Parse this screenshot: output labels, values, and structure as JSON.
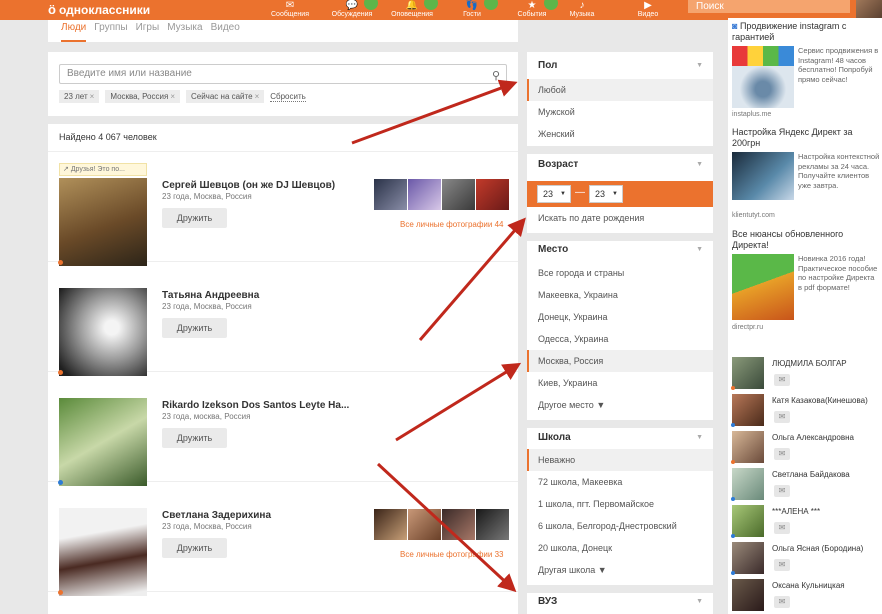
{
  "header": {
    "logo_text": "одноклассники",
    "nav": [
      {
        "label": "Сообщения",
        "icon": "envelope-icon",
        "glyph": "✉"
      },
      {
        "label": "Обсуждения",
        "icon": "chat-icon",
        "glyph": "💬"
      },
      {
        "label": "Оповещения",
        "icon": "bell-icon",
        "glyph": "🔔"
      },
      {
        "label": "Гости",
        "icon": "guests-icon",
        "glyph": "👣"
      },
      {
        "label": "События",
        "icon": "events-icon",
        "glyph": "★"
      },
      {
        "label": "Музыка",
        "icon": "music-icon",
        "glyph": "♪"
      },
      {
        "label": "Видео",
        "icon": "video-icon",
        "glyph": "▶"
      }
    ],
    "search_placeholder": "Поиск"
  },
  "subnav": {
    "tabs": [
      "Люди",
      "Группы",
      "Игры",
      "Музыка",
      "Видео"
    ]
  },
  "search": {
    "placeholder": "Введите имя или название",
    "chips": [
      "23 лет",
      "Москва, Россия",
      "Сейчас на сайте"
    ],
    "reset_label": "Сбросить"
  },
  "results": {
    "found_text": "Найдено 4 067 человек",
    "friends_label": "Друзья! Это по...",
    "add_friend_label": "Дружить",
    "people": [
      {
        "name": "Сергей Шевцов (он же DJ Шевцов)",
        "meta": "23 года, Москва, Россия",
        "all_photos": "Все личные фотографии 44"
      },
      {
        "name": "Татьяна Андреевна",
        "meta": "23 года, Москва, Россия",
        "all_photos": ""
      },
      {
        "name": "Rikardo Izekson Dos Santos Leyte Ha...",
        "meta": "23 года, москва, Россия",
        "all_photos": ""
      },
      {
        "name": "Светлана Задерихина",
        "meta": "23 года, Москва, Россия",
        "all_photos": "Все личные фотографии 33"
      }
    ]
  },
  "filters": {
    "gender": {
      "title": "Пол",
      "options": [
        "Любой",
        "Мужской",
        "Женский"
      ]
    },
    "age": {
      "title": "Возраст",
      "from": "23",
      "to": "23",
      "dash": "—",
      "birthdate_link": "Искать по дате рождения"
    },
    "place": {
      "title": "Место",
      "options": [
        "Все города и страны",
        "Макеевка, Украина",
        "Донецк, Украина",
        "Одесса, Украина",
        "Москва, Россия",
        "Киев, Украина",
        "Другое место ▼"
      ]
    },
    "school": {
      "title": "Школа",
      "options": [
        "Неважно",
        "72 школа, Макеевка",
        "1 школа, пгт. Первомайское",
        "6 школа, Белгород-Днестровский",
        "20 школа, Донецк",
        "Другая школа ▼"
      ]
    },
    "university": {
      "title": "ВУЗ"
    }
  },
  "ads": [
    {
      "title": "Продвижение instagram с гарантией",
      "text": "Сервис продвижения в Instagram! 48 часов бесплатно! Попробуй прямо сейчас!",
      "source": "instaplus.me"
    },
    {
      "title": "Настройка Яндекс Директ за 200грн",
      "text": "Настройка контекстной рекламы за 24 часа. Получайте клиентов уже завтра.",
      "source": "klientutyt.com"
    },
    {
      "title": "Все нюансы обновленного Директа!",
      "text": "Новинка 2016 года! Практическое пособие по настройке Директа в pdf формате!",
      "source": "directpr.ru"
    }
  ],
  "online_friends": [
    "ЛЮДМИЛА БОЛГАР",
    "Катя Казакова(Кинешова)",
    "Ольга Александровна",
    "Светлана Байдакова",
    "***АЛЕНА ***",
    "Ольга Ясная (Бородина)",
    "Оксана Кульницкая"
  ],
  "colors": {
    "brand": "#eb722e",
    "arrow": "#c0281c"
  }
}
